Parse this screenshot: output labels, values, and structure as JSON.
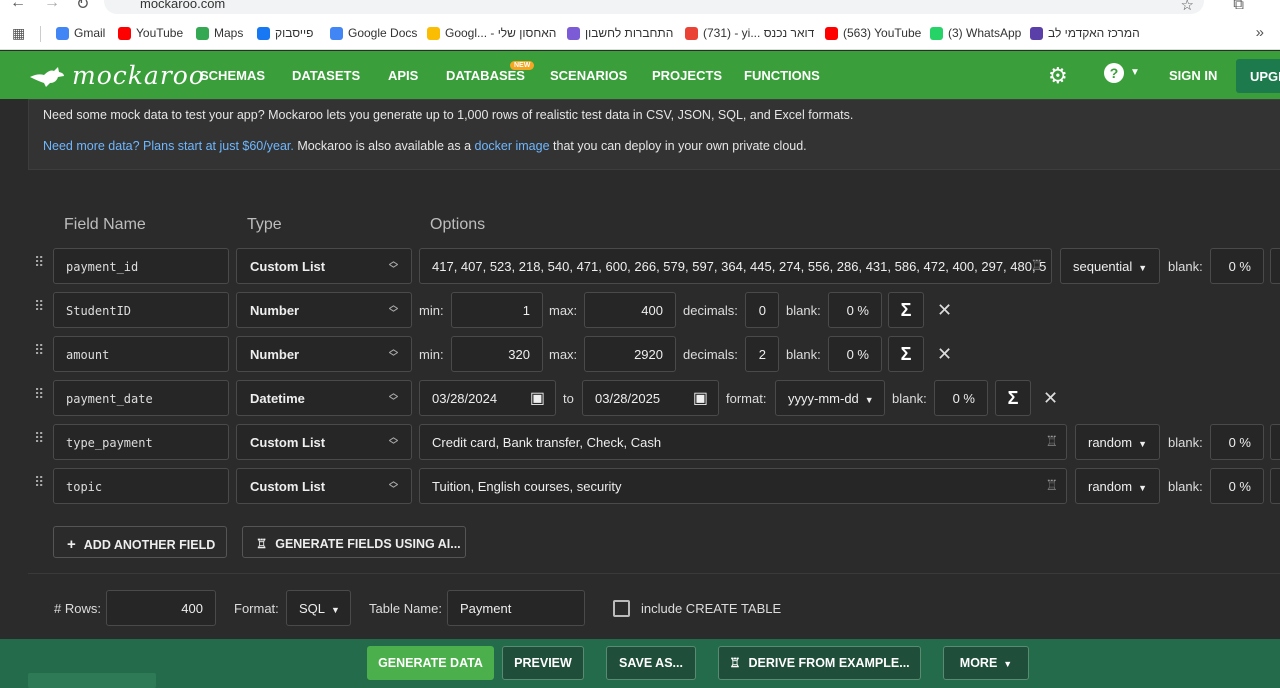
{
  "browser": {
    "url": "mockaroo.com",
    "bookmarks": [
      {
        "label": "Gmail",
        "icon": "google-icon",
        "color": "#4285f4"
      },
      {
        "label": "YouTube",
        "icon": "youtube-icon",
        "color": "#ff0000"
      },
      {
        "label": "Maps",
        "icon": "maps-pin-icon",
        "color": "#34a853"
      },
      {
        "label": "פייסבוק",
        "icon": "facebook-icon",
        "color": "#1877f2"
      },
      {
        "label": "Google Docs",
        "icon": "docs-icon",
        "color": "#4285f4"
      },
      {
        "label": "Googl... - האחסון שלי",
        "icon": "drive-icon",
        "color": "#fbbc04"
      },
      {
        "label": "התחברות לחשבון",
        "icon": "check-icon",
        "color": "#7b5cd6"
      },
      {
        "label": "(731) - yi... דואר נכנס",
        "icon": "gmail-icon",
        "color": "#ea4335"
      },
      {
        "label": "(563) YouTube",
        "icon": "youtube-icon",
        "color": "#ff0000"
      },
      {
        "label": "(3) WhatsApp",
        "icon": "whatsapp-icon",
        "color": "#25d366"
      },
      {
        "label": "המרכז האקדמי לב",
        "icon": "shield-icon",
        "color": "#5b3fa8"
      }
    ]
  },
  "nav": {
    "brand": "mockaroo",
    "links": [
      "SCHEMAS",
      "DATASETS",
      "APIS",
      "DATABASES",
      "SCENARIOS",
      "PROJECTS",
      "FUNCTIONS"
    ],
    "new_badge": "NEW",
    "sign_in": "SIGN IN",
    "upgrade": "UPGR"
  },
  "info": {
    "line1": "Need some mock data to test your app? Mockaroo lets you generate up to 1,000 rows of realistic test data in CSV, JSON, SQL, and Excel formats.",
    "link1": "Need more data? Plans start at just $60/year.",
    "text2": " Mockaroo is also available as a ",
    "link2": "docker image",
    "text3": " that you can deploy in your own private cloud."
  },
  "columns": {
    "field_name": "Field Name",
    "type": "Type",
    "options": "Options"
  },
  "fields": {
    "payment_id": {
      "name": "payment_id",
      "type": "Custom List",
      "values": "417, 407, 523, 218, 540, 471, 600, 266, 579, 597, 364, 445, 274, 556, 286, 431, 586, 472, 400, 297, 480, 5",
      "order": "sequential",
      "blank_label": "blank:",
      "blank": "0 %"
    },
    "student_id": {
      "name": "StudentID",
      "type": "Number",
      "min_label": "min:",
      "min": "1",
      "max_label": "max:",
      "max": "400",
      "decimals_label": "decimals:",
      "decimals": "0",
      "blank_label": "blank:",
      "blank": "0 %"
    },
    "amount": {
      "name": "amount",
      "type": "Number",
      "min_label": "min:",
      "min": "320",
      "max_label": "max:",
      "max": "2920",
      "decimals_label": "decimals:",
      "decimals": "2",
      "blank_label": "blank:",
      "blank": "0 %"
    },
    "payment_date": {
      "name": "payment_date",
      "type": "Datetime",
      "from": "03/28/2024",
      "to_label": "to",
      "to": "03/28/2025",
      "format_label": "format:",
      "format": "yyyy-mm-dd",
      "blank_label": "blank:",
      "blank": "0 %"
    },
    "type_payment": {
      "name": "type_payment",
      "type": "Custom List",
      "values": "Credit card, Bank transfer, Check, Cash",
      "order": "random",
      "blank_label": "blank:",
      "blank": "0 %"
    },
    "topic": {
      "name": "topic",
      "type": "Custom List",
      "values": "Tuition, English courses, security",
      "order": "random",
      "blank_label": "blank:",
      "blank": "0 %"
    }
  },
  "actions": {
    "add_field": "ADD ANOTHER FIELD",
    "generate_ai": "GENERATE FIELDS USING AI..."
  },
  "output": {
    "rows_label": "# Rows:",
    "rows": "400",
    "format_label": "Format:",
    "format": "SQL",
    "table_label": "Table Name:",
    "table": "Payment",
    "create_table_label": "include CREATE TABLE",
    "create_table_checked": false
  },
  "bottom": {
    "generate": "GENERATE DATA",
    "preview": "PREVIEW",
    "save_as": "SAVE AS...",
    "derive": "DERIVE FROM EXAMPLE...",
    "more": "MORE"
  },
  "colors": {
    "accent": "#3a9f3a",
    "bottom_bar": "#236b4a",
    "link": "#6fb7ff"
  }
}
